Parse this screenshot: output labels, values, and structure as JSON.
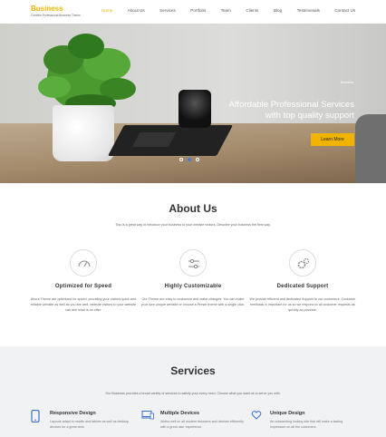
{
  "brand": {
    "name": "Business",
    "tagline": "Creative Professional Business Theme"
  },
  "nav": {
    "items": [
      "Home",
      "About Us",
      "Services",
      "Portfolio",
      "Team",
      "Clients",
      "Blog",
      "Testimonials",
      "Contact Us"
    ],
    "active": "Home"
  },
  "hero": {
    "small_text": "Business",
    "title_line1": "Affordable Professional Services",
    "title_line2": "with top quality support",
    "button_label": "Learn More",
    "slides": 3,
    "active_slide": 2
  },
  "about": {
    "title": "About Us",
    "subtitle": "This is a great way to introduce your business to your website visitors. Describe your business the best way.",
    "features": [
      {
        "icon": "speedometer-icon",
        "title": "Optimized for Speed",
        "text": "About Theme are optimized for speed, providing your visitors quick and reliable website as well as you are well, website visitors to your website can see what is on offer."
      },
      {
        "icon": "sliders-icon",
        "title": "Highly Customizable",
        "text": "Our Theme are easy to customize and make changes. You can make your own unique website or choose a Preset theme with a single click."
      },
      {
        "icon": "gears-icon",
        "title": "Dedicated Support",
        "text": "We provide efficient and dedicated Support to our customers. Customer feedback is important for us so we respond to all customer requests as quickly as possible."
      }
    ]
  },
  "services": {
    "title": "Services",
    "subtitle": "Our Business provides a broad variety of services to satisfy your every need. Choose what you want us to serve you with.",
    "items": [
      {
        "icon": "mobile-icon",
        "title": "Responsive Design",
        "text": "Layouts adapt to mobile and tablets as well as desktop devices for a great view."
      },
      {
        "icon": "devices-icon",
        "title": "Multiple Devices",
        "text": "Works well on all modern browsers and devices efficiently with a great user experience."
      },
      {
        "icon": "heart-icon",
        "title": "Unique Design",
        "text": "An outstanding looking site that will make a lasting impression on all the customers."
      }
    ]
  },
  "colors": {
    "accent": "#f0b400",
    "services_bg": "#f1f2f4",
    "icon_blue": "#3b6fcc"
  }
}
